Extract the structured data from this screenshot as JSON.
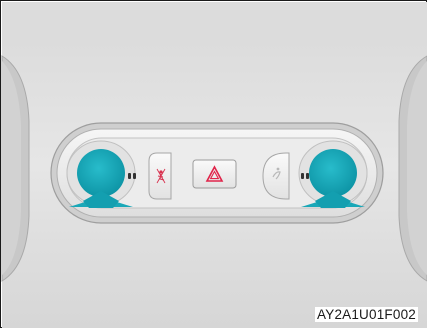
{
  "figure": {
    "code": "AY2A1U01F002"
  },
  "panel": {
    "left_button_icon": "airbag-off-icon",
    "center_button_icon": "hazard-warning-icon",
    "right_button_icon": "seatbelt-reminder-icon",
    "left_knob_icon": "reading-lamp-left-icon",
    "right_knob_icon": "reading-lamp-right-icon"
  },
  "colors": {
    "knob": "#1aa8b8",
    "hazard": "#e0244a",
    "airbag": "#d8324f"
  }
}
